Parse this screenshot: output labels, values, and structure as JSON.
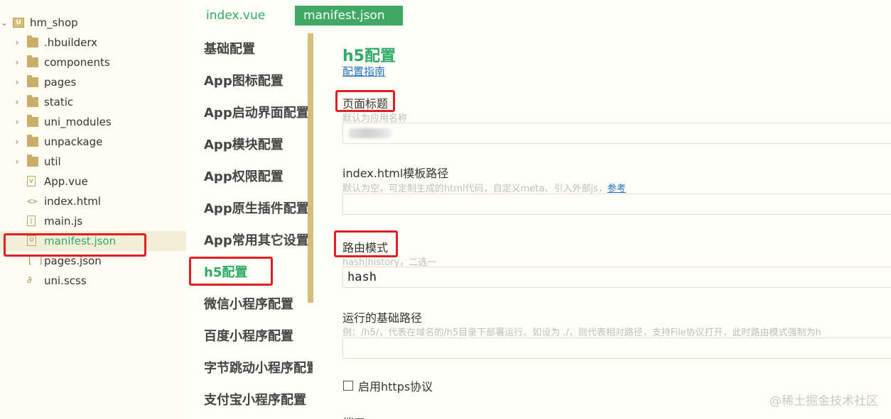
{
  "tree": {
    "project": {
      "name": "hm_shop",
      "icon": "project-icon"
    },
    "items": [
      {
        "label": ".hbuilderx",
        "kind": "folder"
      },
      {
        "label": "components",
        "kind": "folder"
      },
      {
        "label": "pages",
        "kind": "folder"
      },
      {
        "label": "static",
        "kind": "folder"
      },
      {
        "label": "uni_modules",
        "kind": "folder"
      },
      {
        "label": "unpackage",
        "kind": "folder"
      },
      {
        "label": "util",
        "kind": "folder"
      },
      {
        "label": "App.vue",
        "kind": "vue-file"
      },
      {
        "label": "index.html",
        "kind": "html-file"
      },
      {
        "label": "main.js",
        "kind": "js-file"
      },
      {
        "label": "manifest.json",
        "kind": "manifest-file",
        "selected": true
      },
      {
        "label": "pages.json",
        "kind": "json-file"
      },
      {
        "label": "uni.scss",
        "kind": "scss-file"
      }
    ]
  },
  "tabs": [
    {
      "label": "index.vue",
      "active": false
    },
    {
      "label": "manifest.json",
      "active": true
    }
  ],
  "config_nav": [
    "基础配置",
    "App图标配置",
    "App启动界面配置",
    "App模块配置",
    "App权限配置",
    "App原生插件配置",
    "App常用其它设置",
    "h5配置",
    "微信小程序配置",
    "百度小程序配置",
    "字节跳动小程序配置",
    "支付宝小程序配置"
  ],
  "config_nav_active": "h5配置",
  "content": {
    "section_title": "h5配置",
    "guide_link": "配置指南",
    "fields": {
      "page_title": {
        "label": "页面标题",
        "help": "默认为应用名称",
        "value": ""
      },
      "index_template": {
        "label": "index.html模板路径",
        "help": "默认为空，可定制生成的html代码，自定义meta、引入外部js，",
        "help_link": "参考",
        "value": ""
      },
      "router_mode": {
        "label": "路由模式",
        "help": "hash|history，二选一",
        "value": "hash"
      },
      "base_path": {
        "label": "运行的基础路径",
        "help": "例：/h5/，代表在域名的/h5目录下部署运行。如设为 ./，则代表相对路径，支持File协议打开，此时路由模式强制为h",
        "value": ""
      }
    },
    "https_checkbox": {
      "label": "启用https协议",
      "checked": false
    },
    "next_label_partial": "端口"
  },
  "watermark": "@稀土掘金技术社区",
  "colors": {
    "accent": "#3fa862",
    "highlight": "#e02020",
    "link": "#2070c0"
  }
}
